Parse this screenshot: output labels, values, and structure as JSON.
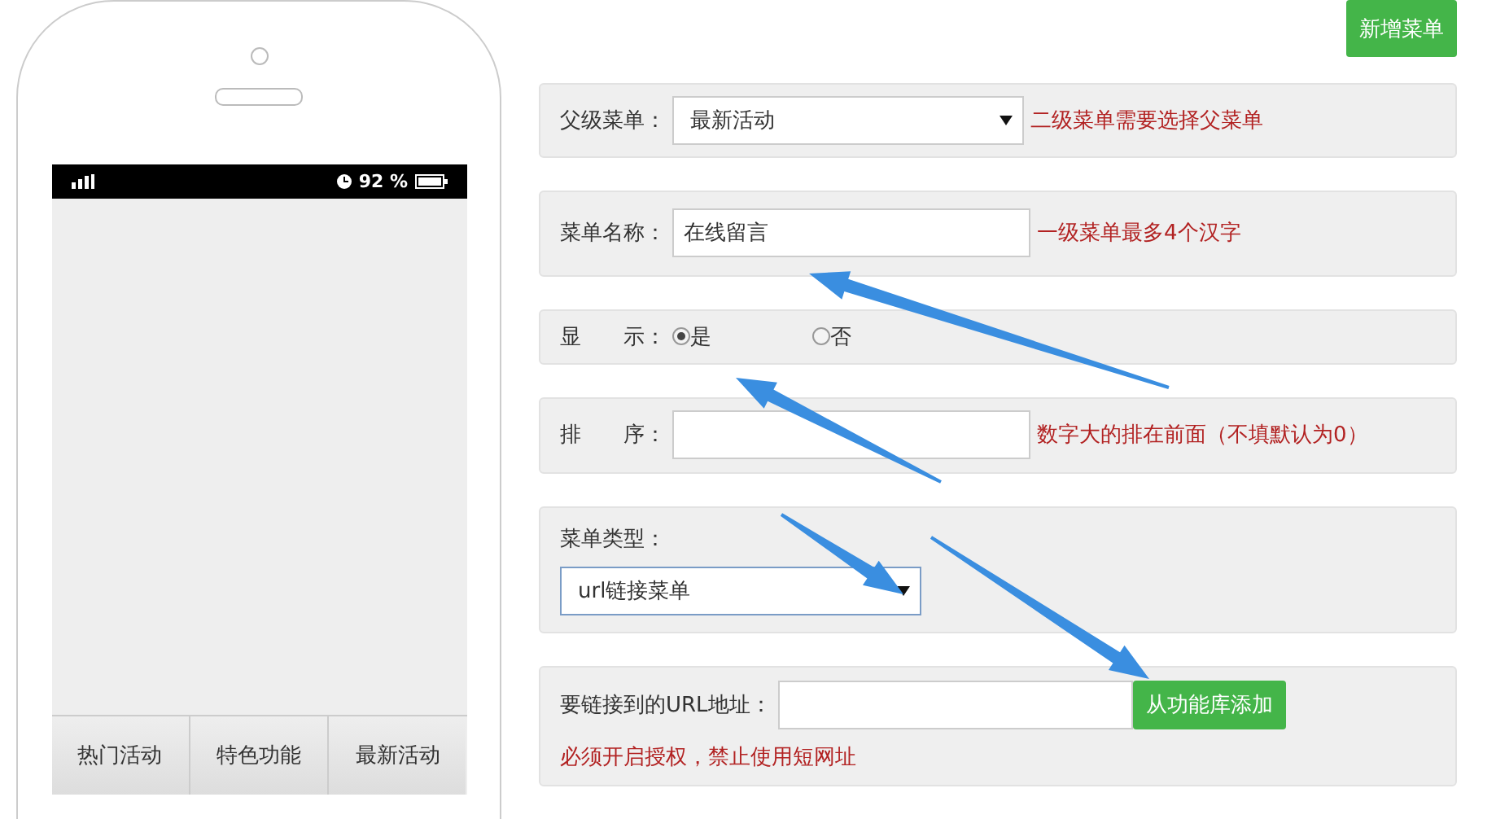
{
  "add_menu_button": "新增菜单",
  "phone": {
    "battery": "92 %",
    "tabs": [
      "热门活动",
      "特色功能",
      "最新活动"
    ]
  },
  "parent_menu": {
    "label": "父级菜单：",
    "value": "最新活动",
    "hint": "二级菜单需要选择父菜单"
  },
  "menu_name": {
    "label": "菜单名称：",
    "value": "在线留言",
    "hint": "一级菜单最多4个汉字"
  },
  "display": {
    "label": "显　　示：",
    "options": [
      {
        "label": "是",
        "selected": true
      },
      {
        "label": "否",
        "selected": false
      }
    ]
  },
  "order": {
    "label": "排　　序：",
    "hint": "数字大的排在前面（不填默认为0）"
  },
  "menu_type": {
    "label": "菜单类型：",
    "value": "url链接菜单"
  },
  "url": {
    "label": "要链接到的URL地址：",
    "button": "从功能库添加",
    "note": "必须开启授权，禁止使用短网址"
  }
}
